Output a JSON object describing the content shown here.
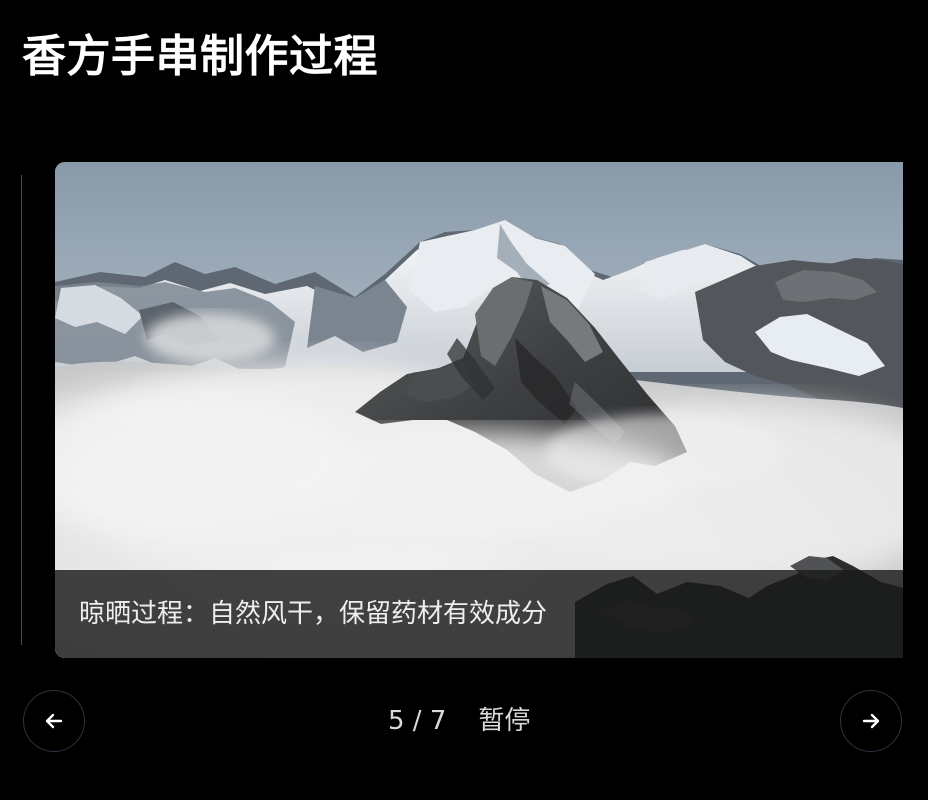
{
  "page": {
    "title": "香方手串制作过程"
  },
  "carousel": {
    "slide": {
      "caption": "晾晒过程：自然风干，保留药材有效成分",
      "image": "snowy-mountains-above-clouds"
    },
    "counter": "5 / 7",
    "pause_label": "暂停",
    "prev_icon": "arrow-left-icon",
    "next_icon": "arrow-right-icon"
  },
  "colors": {
    "background": "#000000",
    "caption_overlay": "#1a1a1a",
    "button_border": "#2f3340",
    "text_primary": "#ffffff",
    "text_secondary": "#d8d8d8"
  }
}
